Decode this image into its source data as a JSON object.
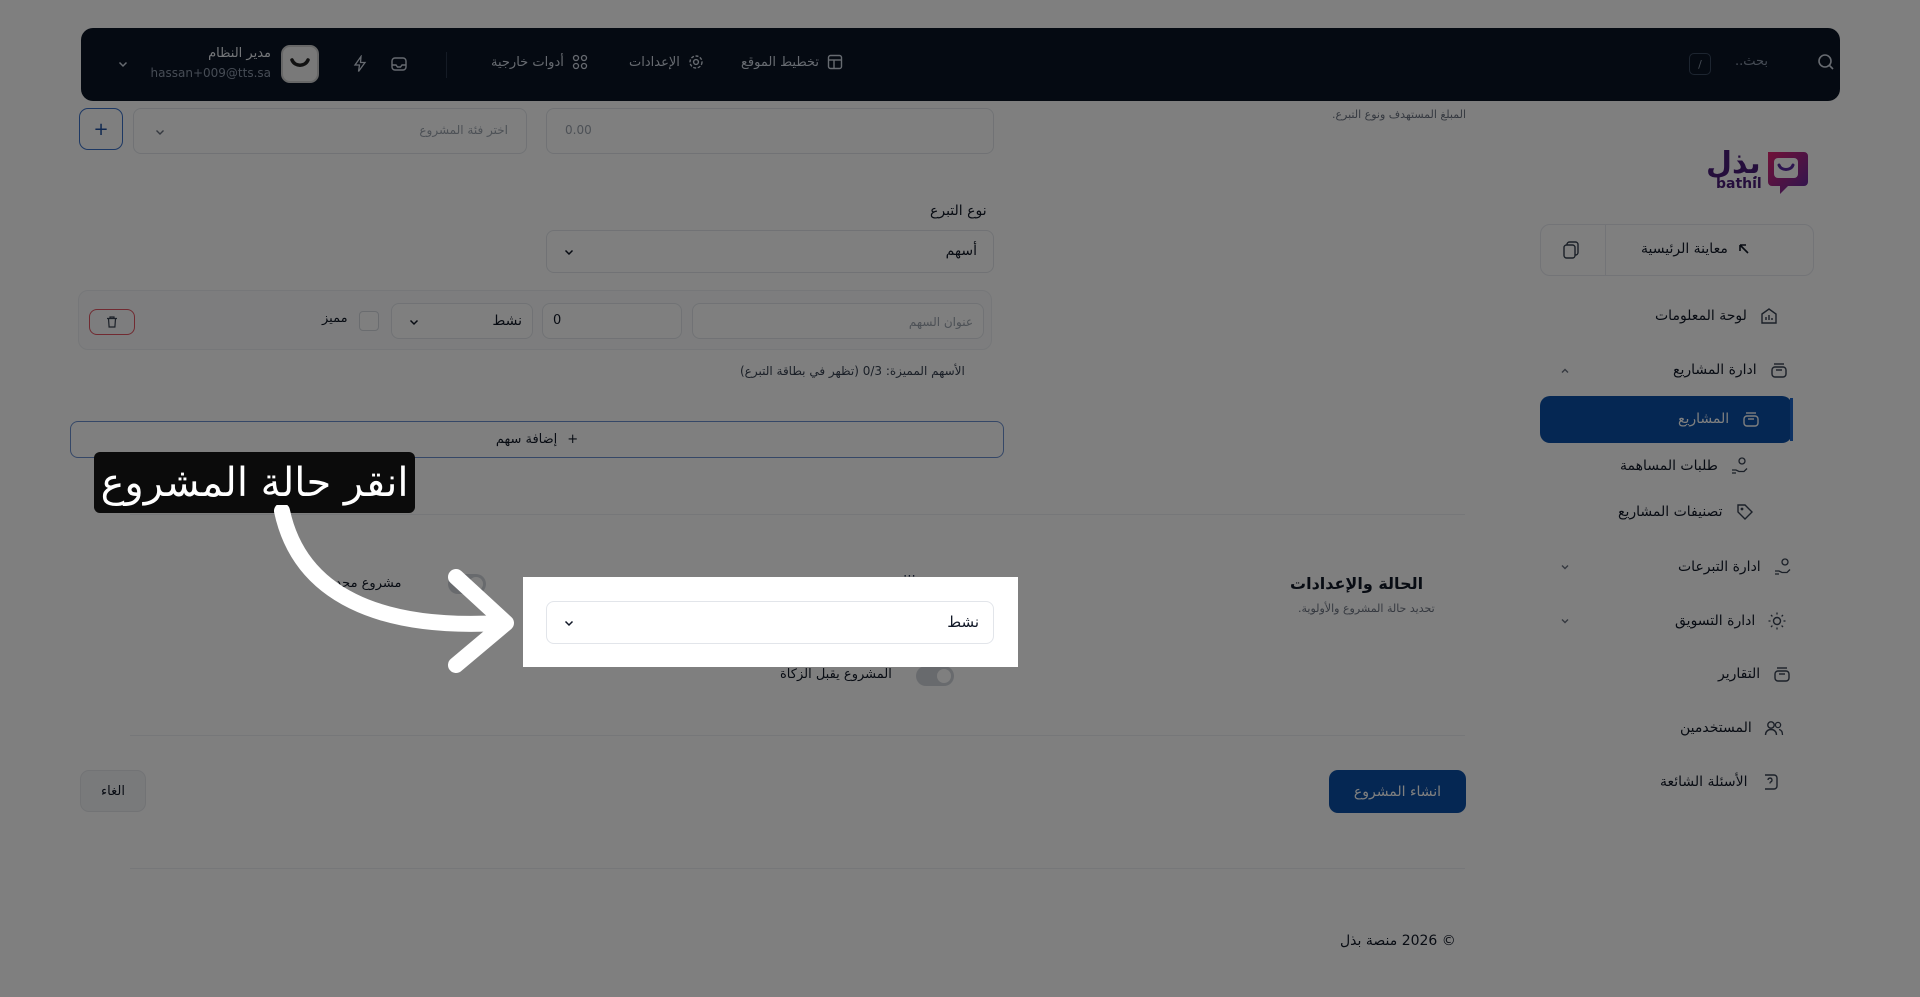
{
  "header": {
    "search_placeholder": "بحث..",
    "search_shortcut": "/",
    "nav": [
      {
        "label": "تخطيط الموقع",
        "icon": "layout-icon"
      },
      {
        "label": "الإعدادات",
        "icon": "gear-icon"
      },
      {
        "label": "أدوات خارجية",
        "icon": "apps-icon"
      }
    ],
    "user": {
      "name": "مدير النظام",
      "email": "hassan+009@tts.sa"
    }
  },
  "sidebar": {
    "logo_ar": "بذل",
    "logo_en": "bathil",
    "preview_label": "معاينة الرئيسية",
    "items": [
      {
        "label": "لوحة المعلومات",
        "icon": "dashboard-icon"
      },
      {
        "label": "ادارة المشاريع",
        "icon": "stack-icon",
        "expanded": true
      },
      {
        "label": "المشاريع",
        "icon": "stack-icon",
        "active": true
      },
      {
        "label": "طلبات المساهمة",
        "icon": "hand-coin-icon"
      },
      {
        "label": "تصنيفات المشاريع",
        "icon": "tag-icon"
      },
      {
        "label": "ادارة التبرعات",
        "icon": "hand-coin-icon"
      },
      {
        "label": "ادارة التسويق",
        "icon": "sun-icon"
      },
      {
        "label": "التقارير",
        "icon": "stack-icon"
      },
      {
        "label": "المستخدمين",
        "icon": "users-icon"
      },
      {
        "label": "الأسئلة الشائعة",
        "icon": "question-icon"
      }
    ]
  },
  "form": {
    "top_hint": "المبلغ المستهدف ونوع التبرع.",
    "amount_placeholder": "0.00",
    "category_placeholder": "اختر فئة المشروع",
    "donation_type_label": "نوع التبرع",
    "donation_type_value": "أسهم",
    "share_row": {
      "title_placeholder": "عنوان السهم",
      "amount_value": "0",
      "status_value": "نشط",
      "featured_label": "مميز"
    },
    "featured_note": "الأسهم المميزة: 0/3 (تظهر في بطاقة التبرع)",
    "add_share_label": "إضافة سهم",
    "status_section": {
      "title": "الحالة والإعدادات",
      "subtitle": "تحديد حالة المشروع والأولوية.",
      "status_value": "نشط",
      "fixed_project_label": "مشروع محدد بـ",
      "zakat_label": "المشروع يقبل الزكاة"
    },
    "create_label": "انشاء المشروع",
    "cancel_label": "الغاء"
  },
  "footer": {
    "text": "© 2026 منصة بذل"
  },
  "overlay": {
    "tip_text": "انقر حالة المشروع"
  },
  "colors": {
    "primary": "#0b4fa6",
    "header_bg": "#0b1524",
    "brand_purple": "#4a1d79",
    "danger": "#e25563"
  }
}
